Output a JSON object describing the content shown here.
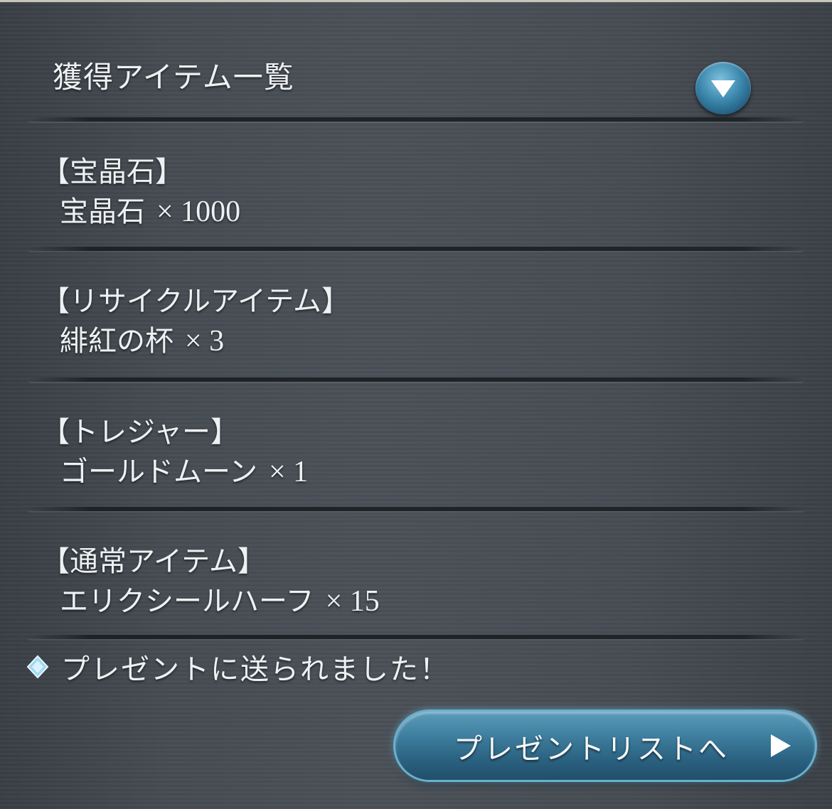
{
  "header": {
    "title": "獲得アイテム一覧",
    "collapse_icon": "chevron-down-icon"
  },
  "sections": [
    {
      "category": "【宝晶石】",
      "item_name": "宝晶石",
      "quantity": "× 1000"
    },
    {
      "category": "【リサイクルアイテム】",
      "item_name": "緋紅の杯",
      "quantity": "× 3"
    },
    {
      "category": "【トレジャー】",
      "item_name": "ゴールドムーン",
      "quantity": "× 1"
    },
    {
      "category": "【通常アイテム】",
      "item_name": "エリクシールハーフ",
      "quantity": "× 15"
    }
  ],
  "notice": {
    "icon": "diamond-gem-icon",
    "text": "プレゼントに送られました！"
  },
  "present_button": {
    "label": "プレゼントリストへ",
    "icon": "play-arrow-icon"
  },
  "colors": {
    "panel_background": "#464c53",
    "text": "#eef1f3",
    "button_accent": "#3f7f9f"
  }
}
